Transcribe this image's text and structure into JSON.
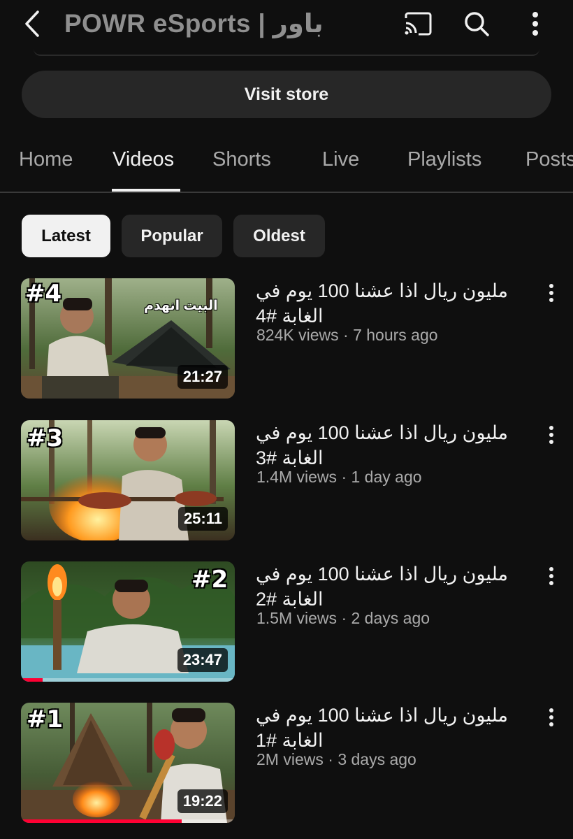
{
  "header": {
    "channel_title": "POWR eSports | باور",
    "back_icon": "chevron-left-icon",
    "cast_icon": "cast-icon",
    "search_icon": "search-icon",
    "more_icon": "more-vert-icon"
  },
  "store_button": {
    "label": "Visit store"
  },
  "tabs": [
    {
      "label": "Home",
      "active": false
    },
    {
      "label": "Videos",
      "active": true
    },
    {
      "label": "Shorts",
      "active": false
    },
    {
      "label": "Live",
      "active": false
    },
    {
      "label": "Playlists",
      "active": false
    },
    {
      "label": "Posts",
      "active": false
    }
  ],
  "filters": [
    {
      "label": "Latest",
      "selected": true
    },
    {
      "label": "Popular",
      "selected": false
    },
    {
      "label": "Oldest",
      "selected": false
    }
  ],
  "videos": [
    {
      "title_line1": "مليون ريال اذا عشنا 100 يوم في",
      "title_line2": "الغابة #4",
      "views": "824K views",
      "age": "7 hours ago",
      "duration": "21:27",
      "episode": "#4",
      "overlay_text": "البيت انهدم",
      "watch_progress": 0
    },
    {
      "title_line1": "مليون ريال اذا عشنا 100 يوم في",
      "title_line2": "الغابة #3",
      "views": "1.4M views",
      "age": "1 day ago",
      "duration": "25:11",
      "episode": "#3",
      "watch_progress": 0
    },
    {
      "title_line1": "مليون ريال اذا عشنا 100 يوم في",
      "title_line2": "الغابة #2",
      "views": "1.5M views",
      "age": "2 days ago",
      "duration": "23:47",
      "episode": "#2",
      "watch_progress": 0.1
    },
    {
      "title_line1": "مليون ريال اذا عشنا 100 يوم في",
      "title_line2": "الغابة #1",
      "views": "2M views",
      "age": "3 days ago",
      "duration": "19:22",
      "episode": "#1",
      "watch_progress": 0.75
    }
  ],
  "meta_separator": "·",
  "colors": {
    "background": "#0f0f0f",
    "chip_bg": "#272727",
    "progress": "#ff0033"
  }
}
